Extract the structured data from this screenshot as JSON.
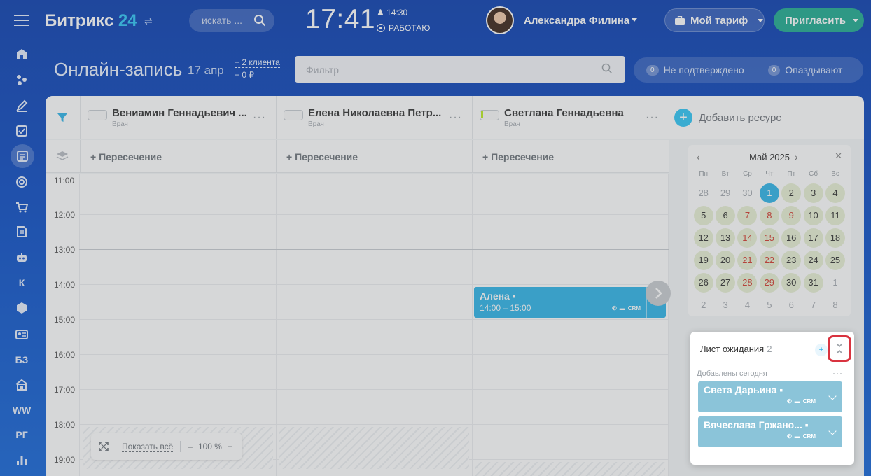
{
  "header": {
    "logo_text": "Битрикс",
    "logo_num": "24",
    "search_placeholder": "искать ...",
    "clock": "17:41",
    "alarm": "14:30",
    "work_status": "РАБОТАЮ",
    "user_name": "Александра Филина",
    "tariff": "Мой тариф",
    "invite": "Пригласить"
  },
  "rail": {
    "items": [
      {
        "icon": "home-icon"
      },
      {
        "icon": "feed-icon"
      },
      {
        "icon": "pen-icon"
      },
      {
        "icon": "tasks-icon"
      },
      {
        "icon": "booking-icon"
      },
      {
        "icon": "target-icon"
      },
      {
        "icon": "cart-icon"
      },
      {
        "icon": "doc-icon"
      },
      {
        "icon": "robot-icon"
      },
      {
        "label": "К"
      },
      {
        "icon": "box-icon"
      },
      {
        "icon": "contact-icon"
      },
      {
        "label": "БЗ"
      },
      {
        "icon": "building-icon"
      },
      {
        "label": "WW"
      },
      {
        "label": "РГ"
      },
      {
        "icon": "chart-icon"
      }
    ]
  },
  "page": {
    "title": "Онлайн-запись",
    "date": "17 апр",
    "stat_clients": "+ 2 клиента",
    "stat_money": "+ 0 ₽",
    "filter_placeholder": "Фильтр",
    "unconfirmed_count": "0",
    "unconfirmed_label": "Не подтверждено",
    "late_count": "0",
    "late_label": "Опаздывают"
  },
  "resources": [
    {
      "name": "Вениамин Геннадьевич ...",
      "role": "Врач"
    },
    {
      "name": "Елена Николаевна Петр...",
      "role": "Врач"
    },
    {
      "name": "Светлана Геннадьевна",
      "role": "Врач"
    }
  ],
  "add_resource": "Добавить ресурс",
  "intersection_label": "+ Пересечение",
  "hours": [
    "11:00",
    "12:00",
    "13:00",
    "14:00",
    "15:00",
    "16:00",
    "17:00",
    "18:00",
    "19:00"
  ],
  "booking": {
    "name": "Алена",
    "time": "14:00 – 15:00",
    "crm": "CRM"
  },
  "zoom": {
    "show_all": "Показать всё",
    "minus": "–",
    "value": "100 %",
    "plus": "+"
  },
  "mini_calendar": {
    "month": "Май 2025",
    "dow": [
      "Пн",
      "Вт",
      "Ср",
      "Чт",
      "Пт",
      "Сб",
      "Вс"
    ],
    "weeks": [
      [
        "28",
        "29",
        "30",
        "1",
        "2",
        "3",
        "4"
      ],
      [
        "5",
        "6",
        "7",
        "8",
        "9",
        "10",
        "11"
      ],
      [
        "12",
        "13",
        "14",
        "15",
        "16",
        "17",
        "18"
      ],
      [
        "19",
        "20",
        "21",
        "22",
        "23",
        "24",
        "25"
      ],
      [
        "26",
        "27",
        "28",
        "29",
        "30",
        "31",
        "1"
      ],
      [
        "2",
        "3",
        "4",
        "5",
        "6",
        "7",
        "8"
      ]
    ]
  },
  "waitlist": {
    "title": "Лист ожидания",
    "count": "2",
    "add": "+",
    "subtitle": "Добавлены сегодня",
    "items": [
      {
        "name": "Света Дарьина",
        "crm": "CRM"
      },
      {
        "name": "Вячеслава Гржано...",
        "crm": "CRM"
      }
    ]
  },
  "colors": {
    "accent": "#2fb4e8",
    "invite": "#1fab91",
    "highlight": "#d9333f"
  }
}
